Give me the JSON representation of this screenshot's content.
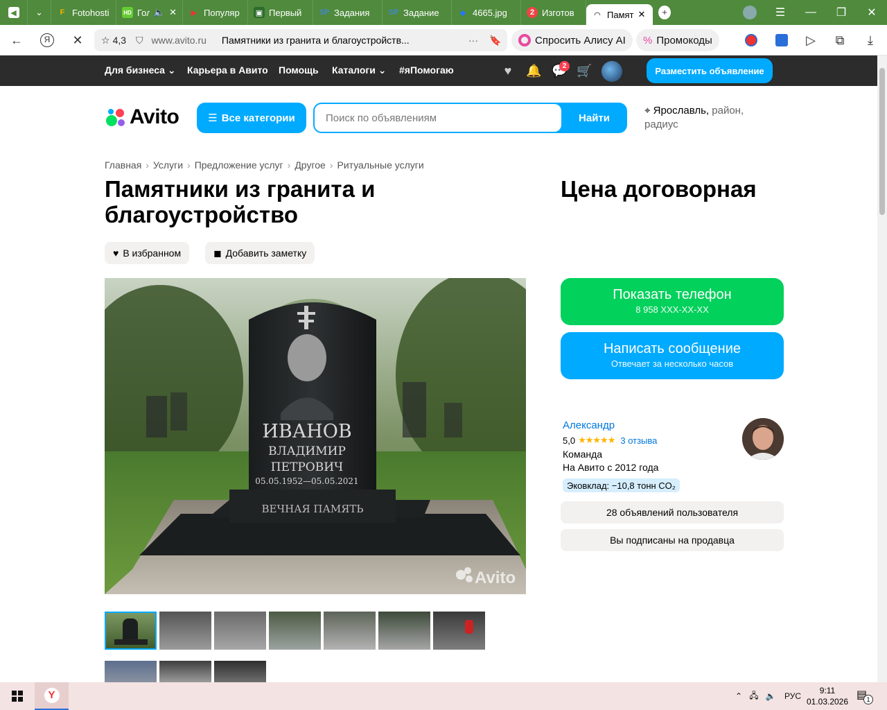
{
  "browser": {
    "tabs": [
      {
        "title": "Fotohosti",
        "icon": "F"
      },
      {
        "title": "Гол",
        "icon": "HD"
      },
      {
        "title": "Популяр",
        "icon": "▶"
      },
      {
        "title": "Первый",
        "icon": "▣"
      },
      {
        "title": "Задания",
        "icon": "SP"
      },
      {
        "title": "Задание",
        "icon": "SP"
      },
      {
        "title": "4665.jpg",
        "icon": "◆"
      },
      {
        "title": "Изготов",
        "icon": "2"
      },
      {
        "title": "Памят",
        "icon": "◠"
      }
    ],
    "rating": "4,3",
    "url": "www.avito.ru",
    "page_title": "Памятники из гранита и благоустройств...",
    "alice_label": "Спросить Алису AI",
    "promo_label": "Промокоды",
    "menu_dots": "···"
  },
  "topnav": {
    "items": [
      "Для бизнеса",
      "Карьера в Авито",
      "Помощь",
      "Каталоги",
      "#яПомогаю"
    ],
    "messages_badge": "2",
    "post_button": "Разместить объявление"
  },
  "header": {
    "logo": "Avito",
    "categories_button": "Все категории",
    "search_placeholder": "Поиск по объявлениям",
    "find_button": "Найти",
    "location_city": "Ярославль,",
    "location_rest": "район, радиус"
  },
  "breadcrumb": [
    "Главная",
    "Услуги",
    "Предложение услуг",
    "Другое",
    "Ритуальные услуги"
  ],
  "listing": {
    "title": "Памятники из гранита и благоустройство",
    "price": "Цена договорная",
    "favorite_button": "В избранном",
    "note_button": "Добавить заметку",
    "monument_surname": "ИВАНОВ",
    "monument_name": "ВЛАДИМИР",
    "monument_patronymic": "ПЕТРОВИЧ",
    "monument_dates": "05.05.1952—05.05.2021",
    "monument_epitaph": "ВЕЧНАЯ ПАМЯТЬ",
    "watermark": "Avito"
  },
  "contact": {
    "phone_button": "Показать телефон",
    "phone_number": "8 958 XXX-XX-XX",
    "message_button": "Написать сообщение",
    "message_sub": "Отвечает за несколько часов"
  },
  "seller": {
    "name": "Александр",
    "rating": "5,0",
    "stars": "★★★★★",
    "reviews": "3 отзыва",
    "type": "Команда",
    "since": "На Авито с 2012 года",
    "eco": "Эковклад: −10,8 тонн CO₂",
    "listings_button": "28 объявлений пользователя",
    "subscribed_button": "Вы подписаны на продавца"
  },
  "taskbar": {
    "lang": "РУС",
    "time": "9:11",
    "date": "01.03.2026",
    "notif_count": "1"
  },
  "colors": {
    "accent": "#00aaff",
    "green": "#02d15c",
    "dark_nav": "#2c2c2c",
    "tabstrip": "#4f8a3d"
  }
}
